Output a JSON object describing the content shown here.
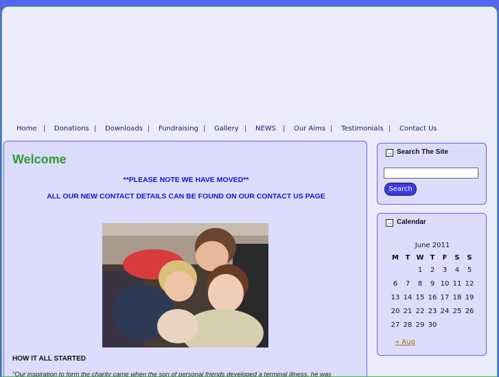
{
  "nav": {
    "items": [
      "Home",
      "Donations",
      "Downloads",
      "Fundraising",
      "Gallery",
      "NEWS",
      "Our Aims",
      "Testimonials",
      "Contact Us"
    ],
    "separator": "|"
  },
  "main": {
    "title": "Welcome",
    "notice1": "**PLEASE NOTE WE HAVE MOVED**",
    "notice2": "ALL OUR NEW CONTACT DETAILS CAN BE FOUND ON OUR CONTACT US PAGE",
    "section_heading": "HOW IT ALL STARTED",
    "section_text": "\"Our inspiration to form the charity came when the son of personal friends developed a terminal illness, he was"
  },
  "search": {
    "title": "Search The Site",
    "input_value": "",
    "button_label": "Search"
  },
  "calendar": {
    "title": "Calendar",
    "caption": "June 2011",
    "weekdays": [
      "M",
      "T",
      "W",
      "T",
      "F",
      "S",
      "S"
    ],
    "weeks": [
      [
        "",
        "",
        "1",
        "2",
        "3",
        "4",
        "5"
      ],
      [
        "6",
        "7",
        "8",
        "9",
        "10",
        "11",
        "12"
      ],
      [
        "13",
        "14",
        "15",
        "16",
        "17",
        "18",
        "19"
      ],
      [
        "20",
        "21",
        "22",
        "23",
        "24",
        "25",
        "26"
      ],
      [
        "27",
        "28",
        "29",
        "30",
        "",
        "",
        ""
      ]
    ],
    "prev_label": "« Aug"
  },
  "colors": {
    "accent_green": "#2e9a2e",
    "notice_blue": "#1212dd",
    "border_blue": "#5566ee"
  }
}
